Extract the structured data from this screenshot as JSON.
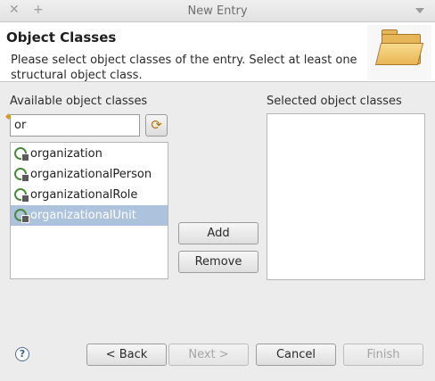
{
  "window": {
    "title": "New Entry",
    "close_glyph": "✕",
    "pin_glyph": "+"
  },
  "header": {
    "title": "Object Classes",
    "description": "Please select object classes of the entry. Select at least one structural object class.",
    "icon": "folder-icon"
  },
  "available": {
    "label": "Available object classes",
    "filter_value": "or",
    "refresh_glyph": "⟳",
    "items": [
      {
        "label": "organization",
        "selected": false
      },
      {
        "label": "organizationalPerson",
        "selected": false
      },
      {
        "label": "organizationalRole",
        "selected": false
      },
      {
        "label": "organizationalUnit",
        "selected": true
      }
    ]
  },
  "actions": {
    "add_label": "Add",
    "remove_label": "Remove"
  },
  "selected": {
    "label": "Selected object classes",
    "items": []
  },
  "footer": {
    "help_glyph": "?",
    "back_label": "< Back",
    "next_label": "Next >",
    "cancel_label": "Cancel",
    "finish_label": "Finish"
  },
  "colors": {
    "selection": "#adc2dc",
    "objectclass_icon": "#4a8a3c"
  }
}
